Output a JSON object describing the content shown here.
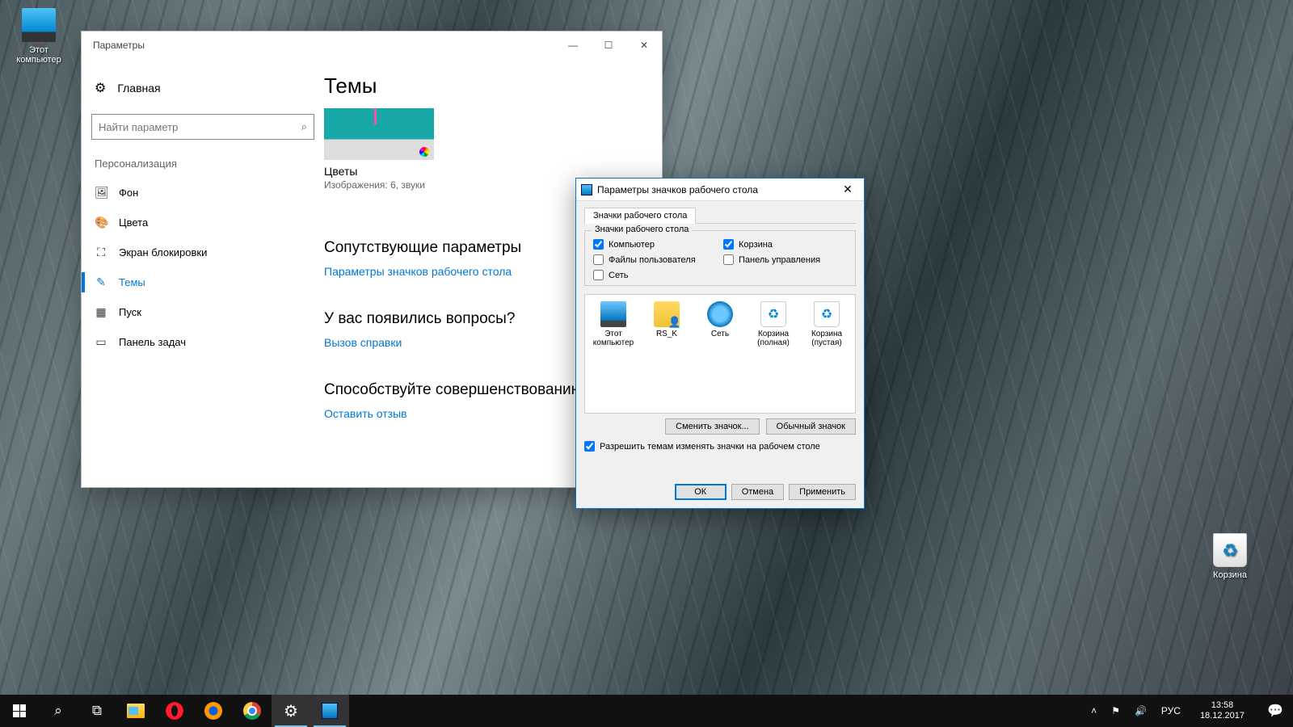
{
  "desktop": {
    "pc_label": "Этот компьютер",
    "bin_label": "Корзина"
  },
  "settings": {
    "title": "Параметры",
    "home": "Главная",
    "search_placeholder": "Найти параметр",
    "section": "Персонализация",
    "nav": [
      {
        "icon": "image",
        "label": "Фон"
      },
      {
        "icon": "palette",
        "label": "Цвета"
      },
      {
        "icon": "lock",
        "label": "Экран блокировки"
      },
      {
        "icon": "brush",
        "label": "Темы",
        "active": true
      },
      {
        "icon": "start",
        "label": "Пуск"
      },
      {
        "icon": "taskbar",
        "label": "Панель задач"
      }
    ],
    "content": {
      "heading": "Темы",
      "theme_name": "Цветы",
      "theme_sub": "Изображения: 6, звуки",
      "related_heading": "Сопутствующие параметры",
      "related_link": "Параметры значков рабочего стола",
      "questions_heading": "У вас появились вопросы?",
      "questions_link": "Вызов справки",
      "feedback_heading": "Способствуйте совершенствованию",
      "feedback_link": "Оставить отзыв"
    }
  },
  "dialog": {
    "title": "Параметры значков рабочего стола",
    "tab": "Значки рабочего стола",
    "group_label": "Значки рабочего стола",
    "checkboxes": {
      "computer": {
        "label": "Компьютер",
        "checked": true
      },
      "bin": {
        "label": "Корзина",
        "checked": true
      },
      "user": {
        "label": "Файлы пользователя",
        "checked": false
      },
      "cpanel": {
        "label": "Панель управления",
        "checked": false
      },
      "network": {
        "label": "Сеть",
        "checked": false
      }
    },
    "preview": {
      "pc": "Этот компьютер",
      "user": "RS_K",
      "net": "Сеть",
      "bin_full": "Корзина (полная)",
      "bin_empty": "Корзина (пустая)"
    },
    "change_icon": "Сменить значок...",
    "default_icon": "Обычный значок",
    "allow_themes": "Разрешить темам изменять значки на рабочем столе",
    "ok": "ОК",
    "cancel": "Отмена",
    "apply": "Применить"
  },
  "taskbar": {
    "tray_up": "˄",
    "lang": "РУС",
    "time": "13:58",
    "date": "18.12.2017"
  }
}
